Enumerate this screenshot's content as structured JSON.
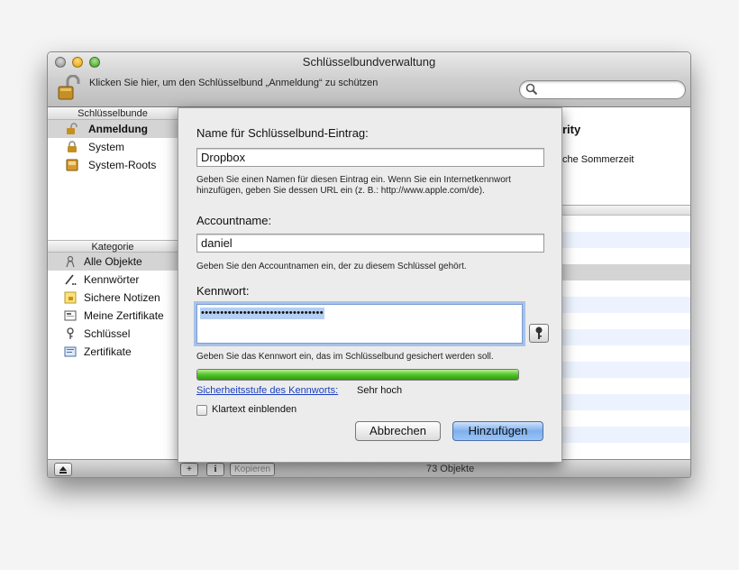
{
  "window": {
    "title": "Schlüsselbundverwaltung",
    "lock_hint": "Klicken Sie hier, um den Schlüsselbund „Anmeldung“ zu schützen",
    "search_placeholder": ""
  },
  "sidebar": {
    "keychains_header": "Schlüsselbunde",
    "keychains": [
      {
        "label": "Anmeldung",
        "icon": "lock-open-icon",
        "selected": true
      },
      {
        "label": "System",
        "icon": "lock-icon",
        "selected": false
      },
      {
        "label": "System-Roots",
        "icon": "cabinet-icon",
        "selected": false
      }
    ],
    "category_header": "Kategorie",
    "categories": [
      {
        "label": "Alle Objekte",
        "icon": "all-items-icon",
        "selected": true
      },
      {
        "label": "Kennwörter",
        "icon": "password-icon",
        "selected": false
      },
      {
        "label": "Sichere Notizen",
        "icon": "secure-note-icon",
        "selected": false
      },
      {
        "label": "Meine Zertifikate",
        "icon": "my-certificate-icon",
        "selected": false
      },
      {
        "label": "Schlüssel",
        "icon": "key-icon",
        "selected": false
      },
      {
        "label": "Zertifikate",
        "icon": "certificate-icon",
        "selected": false
      }
    ]
  },
  "background": {
    "detail_title_fragment": "rity",
    "detail_sub_fragment": "che Sommerzeit",
    "copy_label": "Kopieren",
    "count": "73 Objekte"
  },
  "dialog": {
    "name_label": "Name für Schlüsselbund-Eintrag:",
    "name_value": "Dropbox",
    "name_hint": "Geben Sie einen Namen für diesen Eintrag ein. Wenn Sie ein Internetkennwort hinzufügen, geben Sie dessen URL ein (z. B.: http://www.apple.com/de).",
    "account_label": "Accountname:",
    "account_value": "daniel",
    "account_hint": "Geben Sie den Accountnamen ein, der zu diesem Schlüssel gehört.",
    "password_label": "Kennwort:",
    "password_masked": "••••••••••••••••••••••••••••••••",
    "password_hint": "Geben Sie das Kennwort ein, das im Schlüsselbund gesichert werden soll.",
    "strength_fraction": 1.0,
    "strength_color": "#53c22a",
    "strength_link": "Sicherheitsstufe des Kennworts:",
    "strength_value": "Sehr hoch",
    "show_clear_label": "Klartext einblenden",
    "show_clear_checked": false,
    "cancel_label": "Abbrechen",
    "add_label": "Hinzufügen"
  }
}
